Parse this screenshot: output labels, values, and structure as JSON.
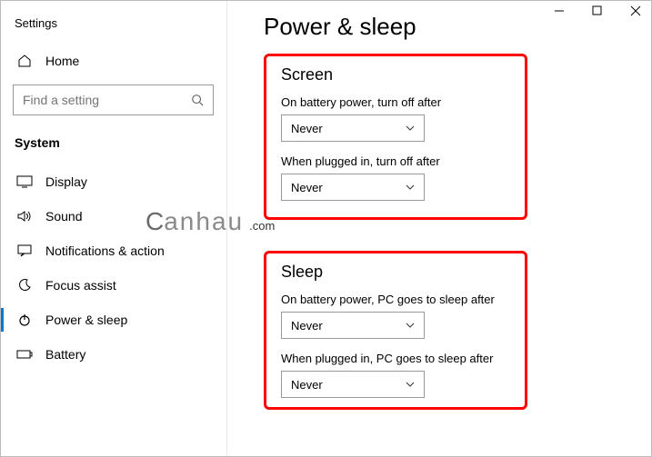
{
  "app": {
    "title": "Settings"
  },
  "sidebar": {
    "home_label": "Home",
    "search_placeholder": "Find a setting",
    "section_label": "System",
    "items": [
      {
        "label": "Display"
      },
      {
        "label": "Sound"
      },
      {
        "label": "Notifications & action"
      },
      {
        "label": "Focus assist"
      },
      {
        "label": "Power & sleep"
      },
      {
        "label": "Battery"
      }
    ]
  },
  "page": {
    "title": "Power & sleep",
    "screen": {
      "title": "Screen",
      "battery_label": "On battery power, turn off after",
      "battery_value": "Never",
      "plugged_label": "When plugged in, turn off after",
      "plugged_value": "Never"
    },
    "sleep": {
      "title": "Sleep",
      "battery_label": "On battery power, PC goes to sleep after",
      "battery_value": "Never",
      "plugged_label": "When plugged in, PC goes to sleep after",
      "plugged_value": "Never"
    }
  },
  "watermark": {
    "part1": "C",
    "part2": "anhau",
    "suffix": ".com"
  }
}
